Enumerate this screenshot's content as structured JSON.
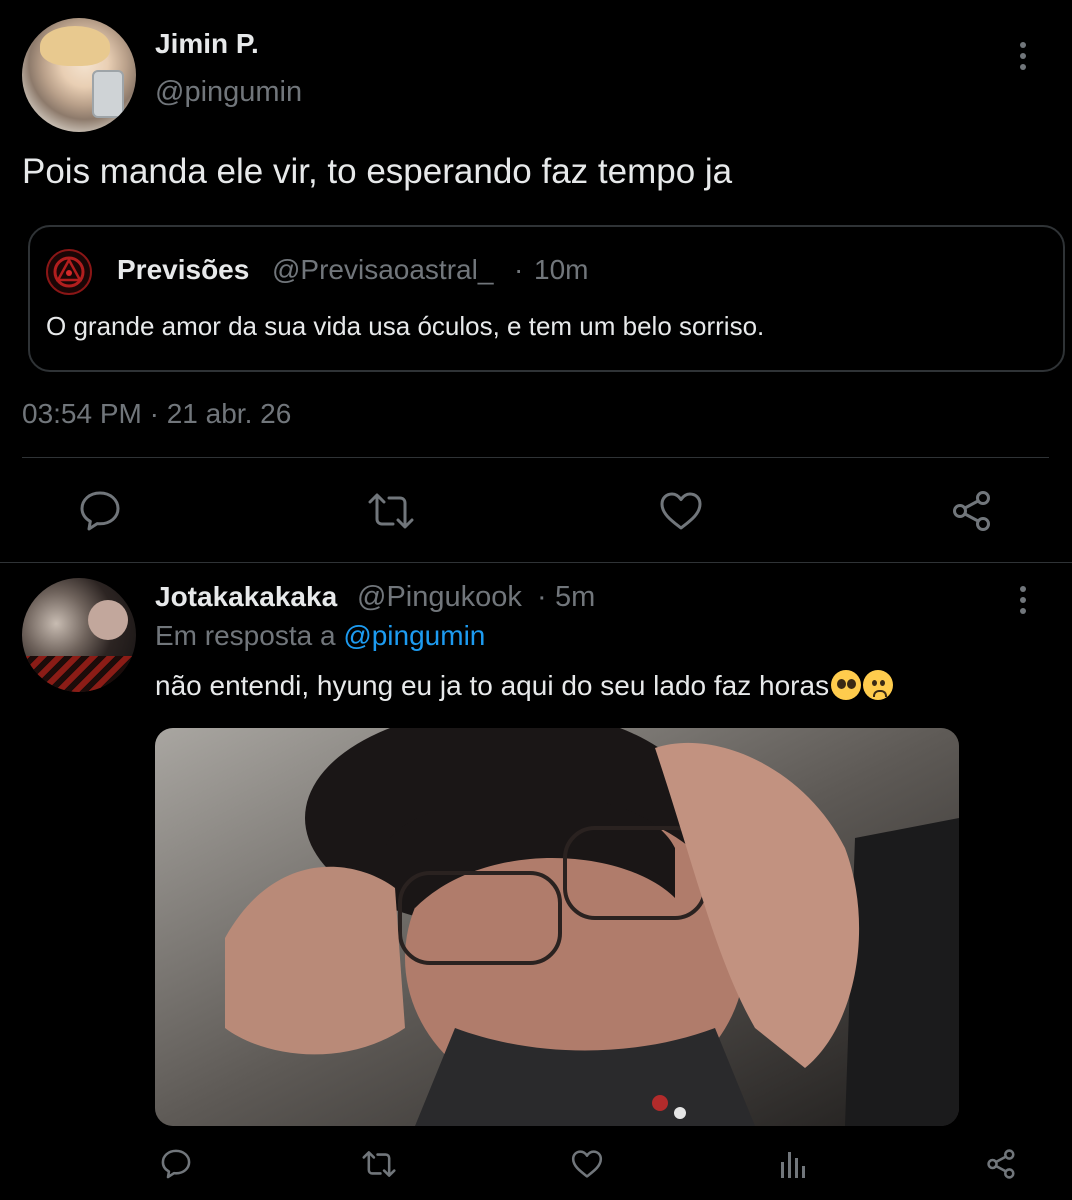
{
  "main_tweet": {
    "display_name": "Jimin P.",
    "handle": "@pingumin",
    "text": "Pois manda ele vir, to esperando faz tempo ja",
    "timestamp": "03:54 PM · 21 abr. 26",
    "quoted": {
      "display_name": "Previsões",
      "handle": "@Previsaoastral_",
      "separator": "·",
      "time": "10m",
      "text": "O grande amor da sua vida usa óculos, e tem um belo sorriso."
    }
  },
  "reply_tweet": {
    "display_name": "Jotakakakaka",
    "handle": "@Pingukook",
    "separator": "·",
    "time": "5m",
    "reply_prefix": "Em resposta a ",
    "reply_mention": "@pingumin",
    "text": "não entendi, hyung eu ja to aqui do seu lado faz horas",
    "emojis": [
      "pleading-face-emoji",
      "slightly-frowning-face-emoji"
    ]
  },
  "icons": {
    "more": "more-options-icon",
    "reply": "reply-icon",
    "retweet": "retweet-icon",
    "like": "like-icon",
    "views": "views-icon",
    "share": "share-icon"
  },
  "colors": {
    "background": "#000000",
    "text_primary": "#e7e9ea",
    "text_secondary": "#71767b",
    "border": "#2f3336",
    "link": "#1d9bf0"
  }
}
